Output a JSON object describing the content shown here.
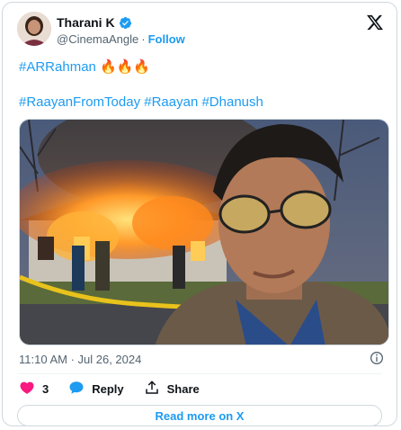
{
  "author": {
    "display_name": "Tharani K",
    "handle": "@CinemaAngle",
    "separator": "·",
    "follow_label": "Follow"
  },
  "tweet": {
    "line1_hashtag": "#ARRahman",
    "line1_emoji": "🔥🔥🔥",
    "hashtags": [
      "#RaayanFromToday",
      "#Raayan",
      "#Dhanush"
    ],
    "timestamp": "11:10 AM · Jul 26, 2024"
  },
  "actions": {
    "like_count": "3",
    "reply_label": "Reply",
    "share_label": "Share"
  },
  "footer": {
    "read_more_label": "Read more on X"
  },
  "icons": {
    "verified": "verified-badge-icon",
    "brand": "x-logo-icon",
    "info": "info-icon",
    "like": "heart-icon",
    "reply": "speech-bubble-icon",
    "share": "share-arrow-icon"
  },
  "colors": {
    "accent": "#1d9bf0",
    "like": "#f91880",
    "text": "#0f1419",
    "muted": "#536471"
  }
}
